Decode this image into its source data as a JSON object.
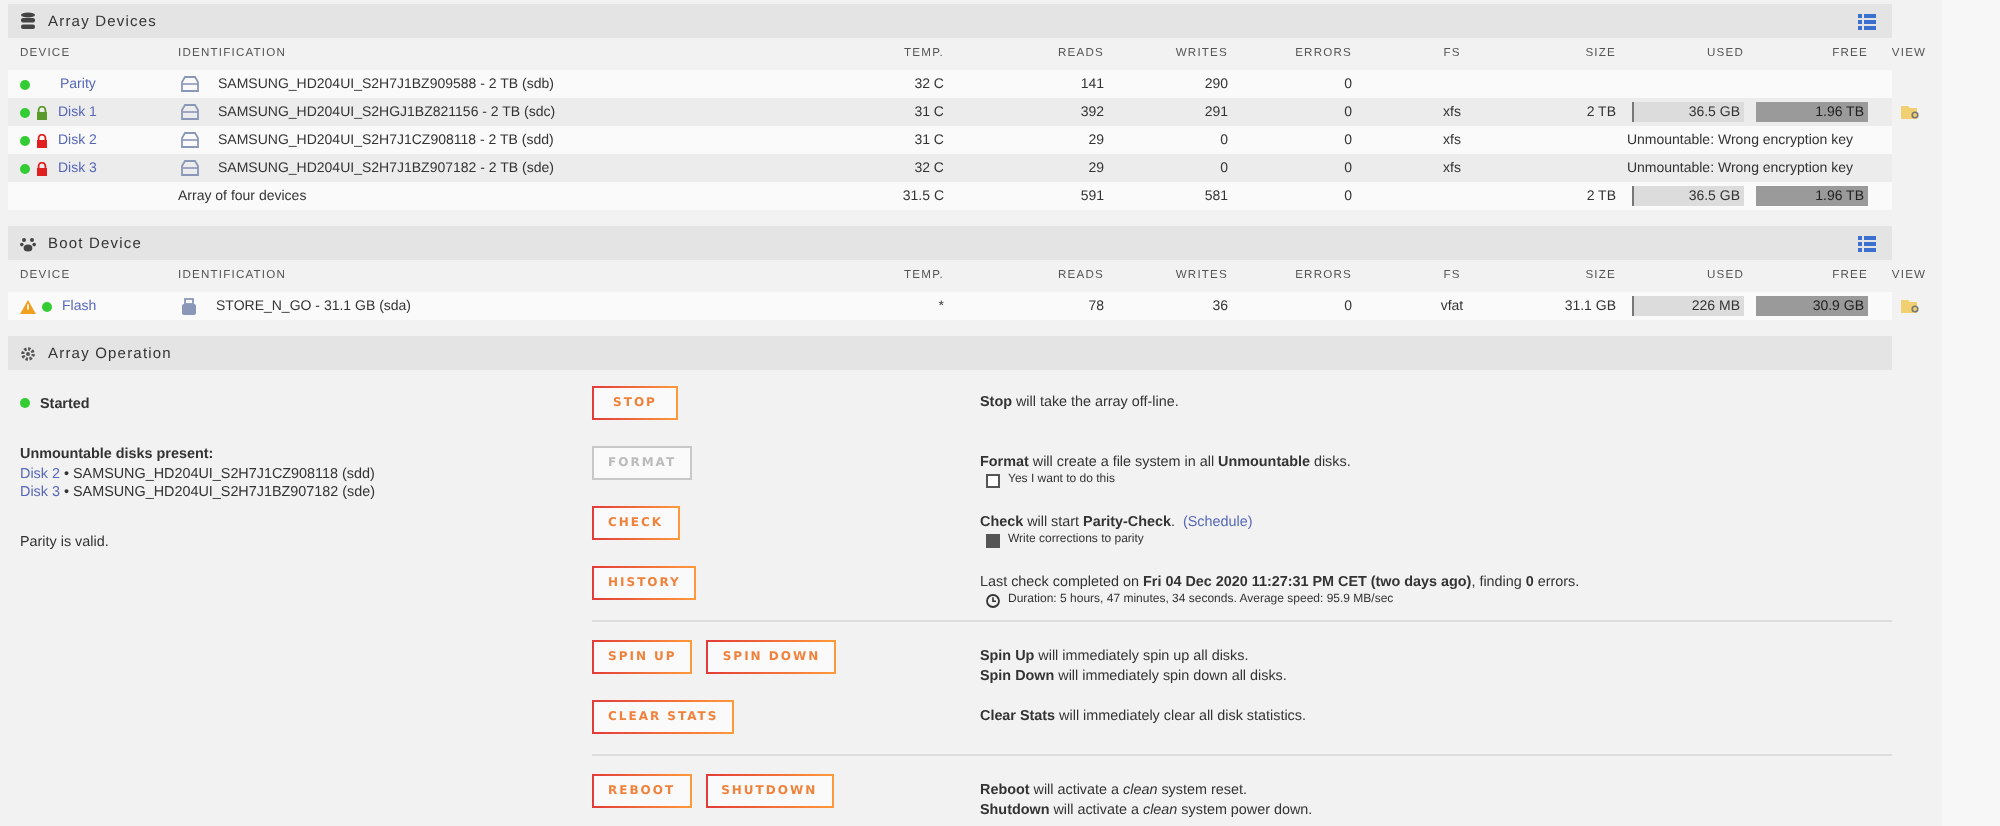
{
  "array_devices": {
    "title": "Array Devices",
    "columns": [
      "DEVICE",
      "IDENTIFICATION",
      "TEMP.",
      "READS",
      "WRITES",
      "ERRORS",
      "FS",
      "SIZE",
      "USED",
      "FREE",
      "VIEW"
    ],
    "rows": [
      {
        "device": "Parity",
        "color": "#33cc33",
        "identification": "SAMSUNG_HD204UI_S2H7J1BZ909588 - 2 TB (sdb)",
        "temp": "32 C",
        "reads": "141",
        "writes": "290",
        "errors": "0"
      },
      {
        "device": "Disk 1",
        "color": "#33cc33",
        "key_ok": true,
        "identification": "SAMSUNG_HD204UI_S2HGJ1BZ821156 - 2 TB (sdc)",
        "temp": "31 C",
        "reads": "392",
        "writes": "291",
        "errors": "0",
        "fs": "xfs",
        "size": "2 TB",
        "used": "36.5 GB",
        "level": 0.02,
        "free": "1.96 TB",
        "browsable": true
      },
      {
        "device": "Disk 2",
        "color": "#33cc33",
        "key_ok": false,
        "identification": "SAMSUNG_HD204UI_S2H7J1CZ908118 - 2 TB (sdd)",
        "temp": "31 C",
        "reads": "29",
        "writes": "0",
        "errors": "0",
        "fs": "xfs",
        "message": "Unmountable: Wrong encryption key"
      },
      {
        "device": "Disk 3",
        "color": "#33cc33",
        "key_ok": false,
        "identification": "SAMSUNG_HD204UI_S2H7J1BZ907182 - 2 TB (sde)",
        "temp": "32 C",
        "reads": "29",
        "writes": "0",
        "errors": "0",
        "fs": "xfs",
        "message": "Unmountable: Wrong encryption key"
      }
    ],
    "total": {
      "identification": "Array of four devices",
      "temp": "31.5 C",
      "reads": "591",
      "writes": "581",
      "errors": "0",
      "size": "2 TB",
      "used": "36.5 GB",
      "level": 0.02,
      "free": "1.96 TB"
    }
  },
  "boot_device": {
    "title": "Boot Device",
    "columns": [
      "DEVICE",
      "IDENTIFICATION",
      "TEMP.",
      "READS",
      "WRITES",
      "ERRORS",
      "FS",
      "SIZE",
      "USED",
      "FREE",
      "VIEW"
    ],
    "rows": [
      {
        "device": "Flash",
        "color": "#33cc33",
        "warning": true,
        "identification": "STORE_N_GO - 31.1 GB (sda)",
        "temp": "*",
        "reads": "78",
        "writes": "36",
        "errors": "0",
        "fs": "vfat",
        "size": "31.1 GB",
        "used": "226 MB",
        "level": 0.01,
        "free": "30.9 GB",
        "browsable": true
      }
    ]
  },
  "array_operation": {
    "title": "Array Operation",
    "status": {
      "label": "Started",
      "color": "#33cc33"
    },
    "unmountable": {
      "title": "Unmountable disks present:",
      "disks": [
        {
          "device": "Disk 2",
          "identification": "• SAMSUNG_HD204UI_S2H7J1CZ908118 (sdd)"
        },
        {
          "device": "Disk 3",
          "identification": "• SAMSUNG_HD204UI_S2H7J1BZ907182 (sde)"
        }
      ]
    },
    "parity": "Parity is valid.",
    "groups": [
      [
        {
          "buttons": [
            {
              "label": "STOP",
              "disabled": false
            }
          ],
          "lines": [
            {
              "kind": "text",
              "text": "**Stop** will take the array off-line."
            }
          ]
        },
        {
          "buttons": [
            {
              "label": "FORMAT",
              "disabled": true
            }
          ],
          "lines": [
            {
              "kind": "text",
              "text": "**Format** will create a file system in all **Unmountable** disks."
            },
            {
              "kind": "checkbox",
              "text": "Yes I want to do this",
              "checked": false
            }
          ]
        },
        {
          "buttons": [
            {
              "label": "CHECK",
              "disabled": false
            }
          ],
          "lines": [
            {
              "kind": "text",
              "text": "**Check** will start **Parity-Check**.",
              "link": "(Schedule)"
            },
            {
              "kind": "checkbox",
              "text": "Write corrections to parity",
              "checked": true
            }
          ]
        },
        {
          "buttons": [
            {
              "label": "HISTORY",
              "disabled": false
            }
          ],
          "lines": [
            {
              "kind": "text",
              "text": "Last check completed on **Fri 04 Dec 2020 11:27:31 PM CET (two days ago)**, finding **0** errors."
            },
            {
              "kind": "duration",
              "text": "Duration: 5 hours, 47 minutes, 34 seconds. Average speed: 95.9 MB/sec"
            }
          ]
        }
      ],
      [
        {
          "buttons": [
            {
              "label": "SPIN UP",
              "disabled": false
            },
            {
              "label": "SPIN DOWN",
              "disabled": false
            }
          ],
          "lines": [
            {
              "kind": "text",
              "text": "**Spin Up** will immediately spin up all disks."
            },
            {
              "kind": "text",
              "text": "**Spin Down** will immediately spin down all disks."
            }
          ]
        },
        {
          "buttons": [
            {
              "label": "CLEAR STATS",
              "disabled": false
            }
          ],
          "lines": [
            {
              "kind": "text",
              "text": "**Clear Stats** will immediately clear all disk statistics."
            }
          ]
        }
      ],
      [
        {
          "buttons": [
            {
              "label": "REBOOT",
              "disabled": false
            },
            {
              "label": "SHUTDOWN",
              "disabled": false
            }
          ],
          "lines": [
            {
              "kind": "text",
              "text": "**Reboot** will activate a *clean* system reset."
            },
            {
              "kind": "text",
              "text": "**Shutdown** will activate a *clean* system power down."
            }
          ]
        }
      ]
    ]
  }
}
